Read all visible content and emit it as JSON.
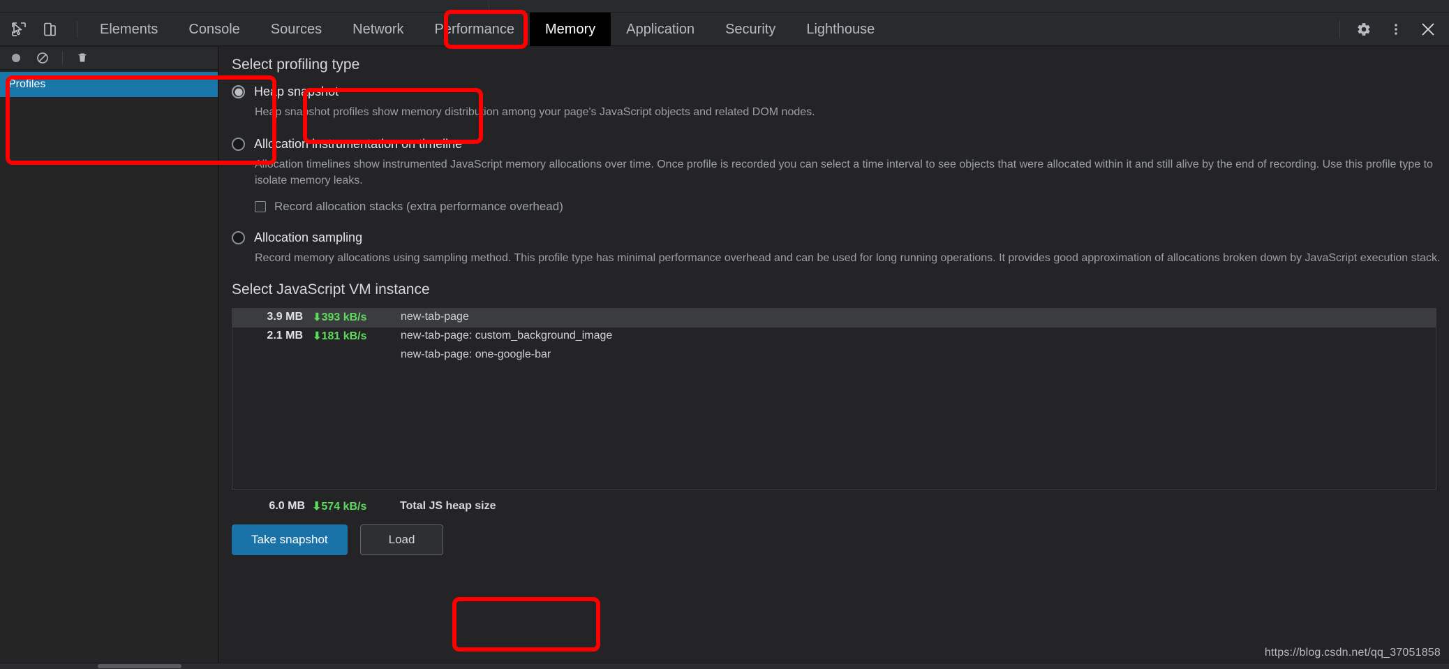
{
  "window": {
    "watermark": "https://blog.csdn.net/qq_37051858"
  },
  "tabbar": {
    "tools": [
      {
        "name": "inspect-element-icon",
        "label": "Inspect element"
      },
      {
        "name": "device-toolbar-icon",
        "label": "Toggle device toolbar"
      }
    ],
    "tabs": [
      {
        "label": "Elements",
        "selected": false
      },
      {
        "label": "Console",
        "selected": false
      },
      {
        "label": "Sources",
        "selected": false
      },
      {
        "label": "Network",
        "selected": false
      },
      {
        "label": "Performance",
        "selected": false
      },
      {
        "label": "Memory",
        "selected": true
      },
      {
        "label": "Application",
        "selected": false
      },
      {
        "label": "Security",
        "selected": false
      },
      {
        "label": "Lighthouse",
        "selected": false
      }
    ],
    "right_icons": [
      {
        "name": "gear-icon",
        "label": "Settings"
      },
      {
        "name": "kebab-menu-icon",
        "label": "Customize and control DevTools"
      },
      {
        "name": "close-icon",
        "label": "Close DevTools"
      }
    ]
  },
  "sidebar": {
    "toolbar": [
      {
        "name": "record-icon",
        "label": "Start recording heap profile"
      },
      {
        "name": "clear-icon",
        "label": "Clear all profiles"
      },
      {
        "name": "trash-icon",
        "label": "Delete profile"
      }
    ],
    "tree": {
      "profiles_label": "Profiles"
    }
  },
  "main": {
    "profiling_section_title": "Select profiling type",
    "options": [
      {
        "id": "heap-snapshot",
        "label": "Heap snapshot",
        "selected": true,
        "description": "Heap snapshot profiles show memory distribution among your page's JavaScript objects and related DOM nodes."
      },
      {
        "id": "allocation-instrumentation",
        "label": "Allocation instrumentation on timeline",
        "selected": false,
        "description": "Allocation timelines show instrumented JavaScript memory allocations over time. Once profile is recorded you can select a time interval to see objects that were allocated within it and still alive by the end of recording. Use this profile type to isolate memory leaks.",
        "checkbox": {
          "label": "Record allocation stacks (extra performance overhead)",
          "checked": false
        }
      },
      {
        "id": "allocation-sampling",
        "label": "Allocation sampling",
        "selected": false,
        "description": "Record memory allocations using sampling method. This profile type has minimal performance overhead and can be used for long running operations. It provides good approximation of allocations broken down by JavaScript execution stack."
      }
    ],
    "vm_section_title": "Select JavaScript VM instance",
    "vm_rows": [
      {
        "size": "3.9 MB",
        "rate": "393 kB/s",
        "name": "new-tab-page",
        "selected": true
      },
      {
        "size": "2.1 MB",
        "rate": "181 kB/s",
        "name": "new-tab-page: custom_background_image",
        "selected": false,
        "subname": "new-tab-page: one-google-bar"
      }
    ],
    "total": {
      "size": "6.0 MB",
      "rate": "574 kB/s",
      "label": "Total JS heap size"
    },
    "buttons": {
      "take_snapshot": "Take snapshot",
      "load": "Load"
    }
  },
  "colors": {
    "accent_blue": "#1a73a8",
    "selection_blue": "#1976a8",
    "rate_green": "#5cdb5c",
    "annotation_red": "#ff0000",
    "panel_bg": "#242426",
    "toolbar_bg": "#292a2d"
  }
}
